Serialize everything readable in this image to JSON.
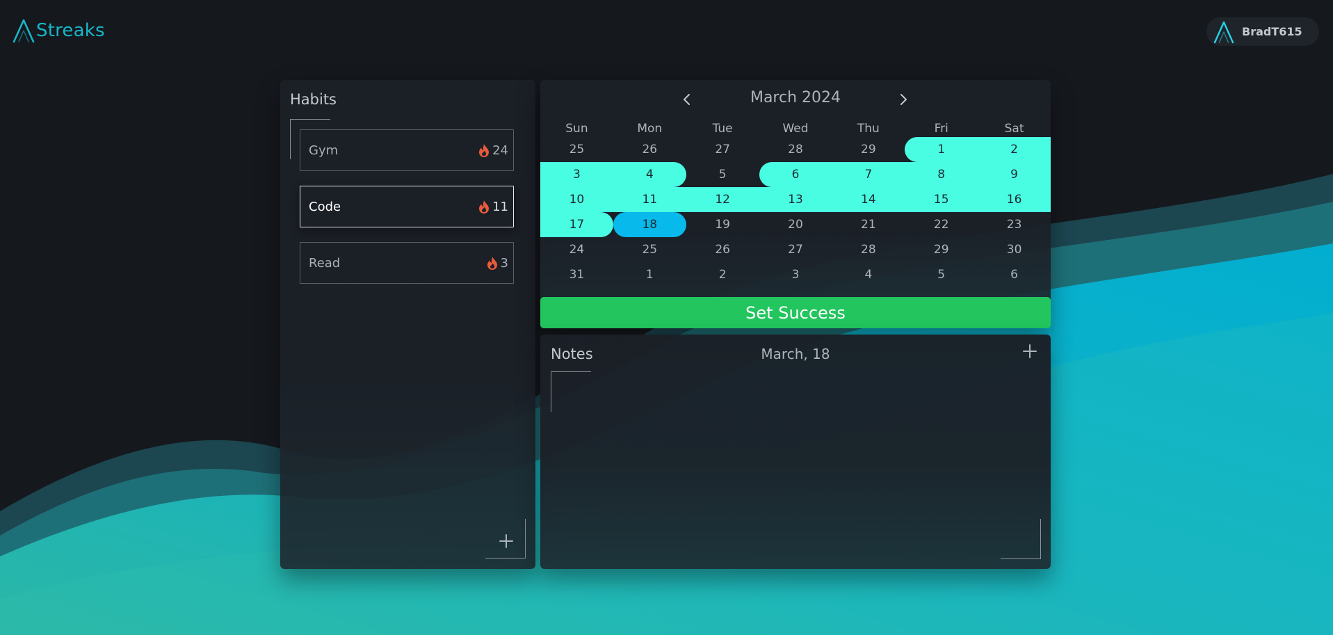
{
  "app": {
    "name": "Streaks",
    "user": "BradT615",
    "colors": {
      "accent": "#17b7c9",
      "streak_fill": "#49fde3",
      "selected_day": "#08b9eb",
      "success": "#22c55e",
      "flame": "#e85a3c"
    }
  },
  "habits": {
    "title": "Habits",
    "items": [
      {
        "name": "Gym",
        "streak": "24",
        "active": false
      },
      {
        "name": "Code",
        "streak": "11",
        "active": true
      },
      {
        "name": "Read",
        "streak": "3",
        "active": false
      }
    ],
    "add_icon": "plus-icon"
  },
  "calendar": {
    "month_label": "March 2024",
    "prev_icon": "chevron-left-icon",
    "next_icon": "chevron-right-icon",
    "weekdays": [
      "Sun",
      "Mon",
      "Tue",
      "Wed",
      "Thu",
      "Fri",
      "Sat"
    ],
    "weeks": [
      [
        "25",
        "26",
        "27",
        "28",
        "29",
        "1",
        "2"
      ],
      [
        "3",
        "4",
        "5",
        "6",
        "7",
        "8",
        "9"
      ],
      [
        "10",
        "11",
        "12",
        "13",
        "14",
        "15",
        "16"
      ],
      [
        "17",
        "18",
        "19",
        "20",
        "21",
        "22",
        "23"
      ],
      [
        "24",
        "25",
        "26",
        "27",
        "28",
        "29",
        "30"
      ],
      [
        "31",
        "1",
        "2",
        "3",
        "4",
        "5",
        "6"
      ]
    ],
    "success_days": [
      "2024-03-01",
      "2024-03-02",
      "2024-03-03",
      "2024-03-04",
      "2024-03-06",
      "2024-03-07",
      "2024-03-08",
      "2024-03-09",
      "2024-03-10",
      "2024-03-11",
      "2024-03-12",
      "2024-03-13",
      "2024-03-14",
      "2024-03-15",
      "2024-03-16",
      "2024-03-17"
    ],
    "selected_day": "2024-03-18",
    "set_success_label": "Set Success"
  },
  "notes": {
    "title": "Notes",
    "date_label": "March, 18",
    "add_icon": "plus-icon"
  }
}
